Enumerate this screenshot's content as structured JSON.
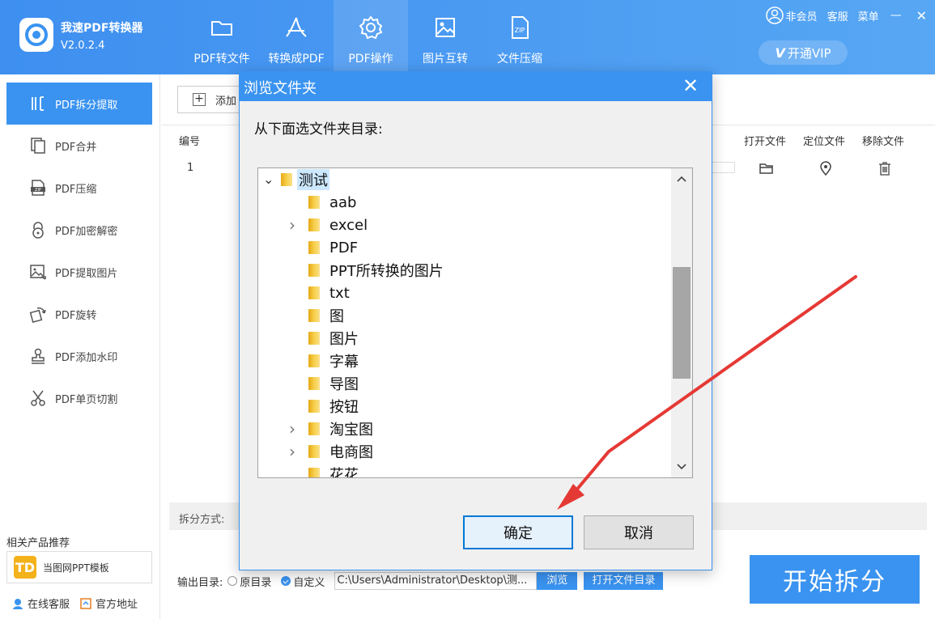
{
  "app": {
    "name": "我速PDF转换器",
    "version": "V2.0.2.4"
  },
  "nav": [
    {
      "label": "PDF转文件",
      "icon": "folder-icon"
    },
    {
      "label": "转换成PDF",
      "icon": "pdf-icon"
    },
    {
      "label": "PDF操作",
      "icon": "gear-icon"
    },
    {
      "label": "图片互转",
      "icon": "image-icon"
    },
    {
      "label": "文件压缩",
      "icon": "zip-icon"
    }
  ],
  "topright": {
    "member": "非会员",
    "service": "客服",
    "menu": "菜单",
    "minimize": "—",
    "close": "✕"
  },
  "vip": {
    "label": "开通VIP",
    "badge": "V"
  },
  "sidebar": {
    "items": [
      {
        "label": "PDF拆分提取",
        "icon": "split-icon"
      },
      {
        "label": "PDF合并",
        "icon": "merge-icon"
      },
      {
        "label": "PDF压缩",
        "icon": "zip-icon"
      },
      {
        "label": "PDF加密解密",
        "icon": "lock-icon"
      },
      {
        "label": "PDF提取图片",
        "icon": "image-icon"
      },
      {
        "label": "PDF旋转",
        "icon": "rotate-icon"
      },
      {
        "label": "PDF添加水印",
        "icon": "stamp-icon"
      },
      {
        "label": "PDF单页切割",
        "icon": "scissors-icon"
      }
    ],
    "related_title": "相关产品推荐",
    "related_product": "当图网PPT模板",
    "related_logo": "TD",
    "online_service": "在线客服",
    "official_site": "官方地址"
  },
  "main": {
    "add_label": "添加",
    "table_headers": {
      "num": "编号",
      "open": "打开文件",
      "locate": "定位文件",
      "remove": "移除文件"
    },
    "row_num": "1",
    "split_label": "拆分方式:",
    "output_label": "输出目录:",
    "option_original": "原目录",
    "option_custom": "自定义",
    "output_path": "C:\\Users\\Administrator\\Desktop\\测...",
    "browse": "浏览",
    "open_dir": "打开文件目录",
    "start": "开始拆分"
  },
  "dialog": {
    "title": "浏览文件夹",
    "close": "✕",
    "prompt": "从下面选文件夹目录:",
    "tree": [
      {
        "label": "测试",
        "expander": "⌄",
        "selected": true
      },
      {
        "label": "aab",
        "expander": ""
      },
      {
        "label": "excel",
        "expander": "›"
      },
      {
        "label": "PDF",
        "expander": ""
      },
      {
        "label": "PPT所转换的图片",
        "expander": ""
      },
      {
        "label": "txt",
        "expander": ""
      },
      {
        "label": "图",
        "expander": ""
      },
      {
        "label": "图片",
        "expander": ""
      },
      {
        "label": "字幕",
        "expander": ""
      },
      {
        "label": "导图",
        "expander": ""
      },
      {
        "label": "按钮",
        "expander": ""
      },
      {
        "label": "淘宝图",
        "expander": "›"
      },
      {
        "label": "电商图",
        "expander": "›"
      },
      {
        "label": "花花",
        "expander": ""
      }
    ],
    "ok": "确定",
    "cancel": "取消"
  },
  "colors": {
    "accent": "#3a93f0",
    "annotation_arrow": "#e53935"
  }
}
